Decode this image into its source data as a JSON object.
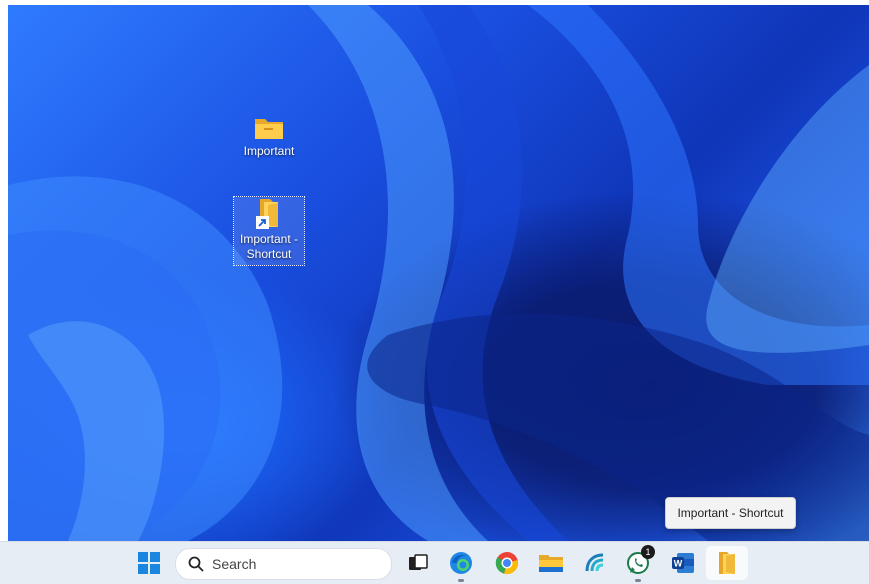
{
  "desktop": {
    "icons": [
      {
        "label": "Important",
        "icon": "folder-icon"
      },
      {
        "label_line1": "Important -",
        "label_line2": "Shortcut",
        "icon": "folder-shortcut-icon",
        "selected": true
      }
    ]
  },
  "tooltip": {
    "text": "Important - Shortcut"
  },
  "taskbar": {
    "search_label": "Search",
    "apps": [
      {
        "name": "start-button",
        "icon": "windows-logo-icon"
      },
      {
        "name": "task-view-button",
        "icon": "task-view-icon"
      },
      {
        "name": "edge",
        "icon": "edge-icon"
      },
      {
        "name": "chrome",
        "icon": "chrome-icon"
      },
      {
        "name": "file-explorer",
        "icon": "folder-icon"
      },
      {
        "name": "app",
        "icon": "wave-app-icon"
      },
      {
        "name": "whatsapp",
        "icon": "whatsapp-icon",
        "badge": "1"
      },
      {
        "name": "word",
        "icon": "word-icon"
      },
      {
        "name": "important-shortcut",
        "icon": "folder-shortcut-icon",
        "active": true
      }
    ]
  },
  "colors": {
    "accent": "#1f5cf0",
    "taskbar": "#e7edf5"
  }
}
